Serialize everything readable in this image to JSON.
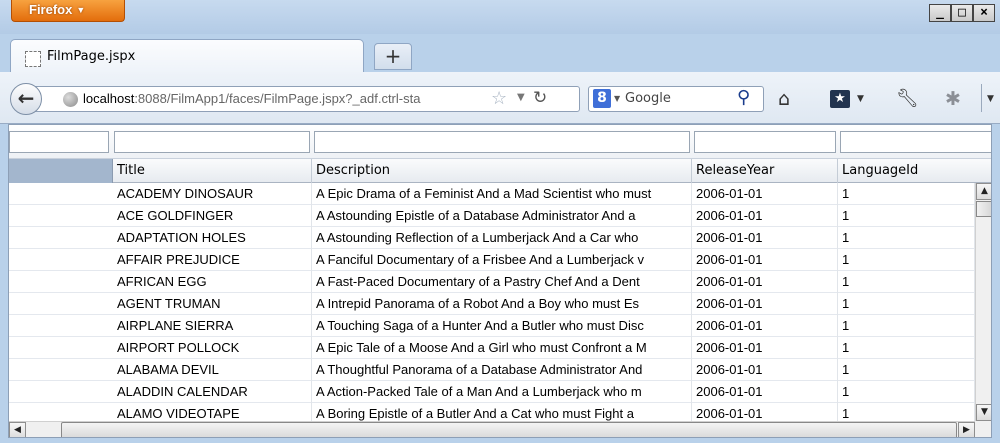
{
  "window": {
    "app_menu_label": "Firefox",
    "min_glyph": "_",
    "max_glyph": "□",
    "close_glyph": "×"
  },
  "tabs": [
    {
      "label": "FilmPage.jspx",
      "active": true
    }
  ],
  "new_tab_glyph": "+",
  "navbar": {
    "url_host": "localhost",
    "url_rest": ":8088/FilmApp1/faces/FilmPage.jspx?_adf.ctrl-sta",
    "search_engine_letter": "8",
    "search_placeholder": "Google"
  },
  "table": {
    "columns": [
      "Title",
      "Description",
      "ReleaseYear",
      "LanguageId"
    ],
    "rows": [
      [
        "ACADEMY DINOSAUR",
        "A Epic Drama of a Feminist And a Mad Scientist who must",
        "2006-01-01",
        "1"
      ],
      [
        "ACE GOLDFINGER",
        "A Astounding Epistle of a Database Administrator And a",
        "2006-01-01",
        "1"
      ],
      [
        "ADAPTATION HOLES",
        "A Astounding Reflection of a Lumberjack And a Car who",
        "2006-01-01",
        "1"
      ],
      [
        "AFFAIR PREJUDICE",
        "A Fanciful Documentary of a Frisbee And a Lumberjack v",
        "2006-01-01",
        "1"
      ],
      [
        "AFRICAN EGG",
        "A Fast-Paced Documentary of a Pastry Chef And a Dent",
        "2006-01-01",
        "1"
      ],
      [
        "AGENT TRUMAN",
        "A Intrepid Panorama of a Robot And a Boy who must Es",
        "2006-01-01",
        "1"
      ],
      [
        "AIRPLANE SIERRA",
        "A Touching Saga of a Hunter And a Butler who must Disc",
        "2006-01-01",
        "1"
      ],
      [
        "AIRPORT POLLOCK",
        "A Epic Tale of a Moose And a Girl who must Confront a M",
        "2006-01-01",
        "1"
      ],
      [
        "ALABAMA DEVIL",
        "A Thoughtful Panorama of a Database Administrator And",
        "2006-01-01",
        "1"
      ],
      [
        "ALADDIN CALENDAR",
        "A Action-Packed Tale of a Man And a Lumberjack who m",
        "2006-01-01",
        "1"
      ],
      [
        "ALAMO VIDEOTAPE",
        "A Boring Epistle of a Butler And a Cat who must Fight a",
        "2006-01-01",
        "1"
      ]
    ]
  },
  "colors": {
    "firefox_button": "#e8760f",
    "chrome_background": "#b9d1ea",
    "row_header_column": "#a3b6cd"
  }
}
